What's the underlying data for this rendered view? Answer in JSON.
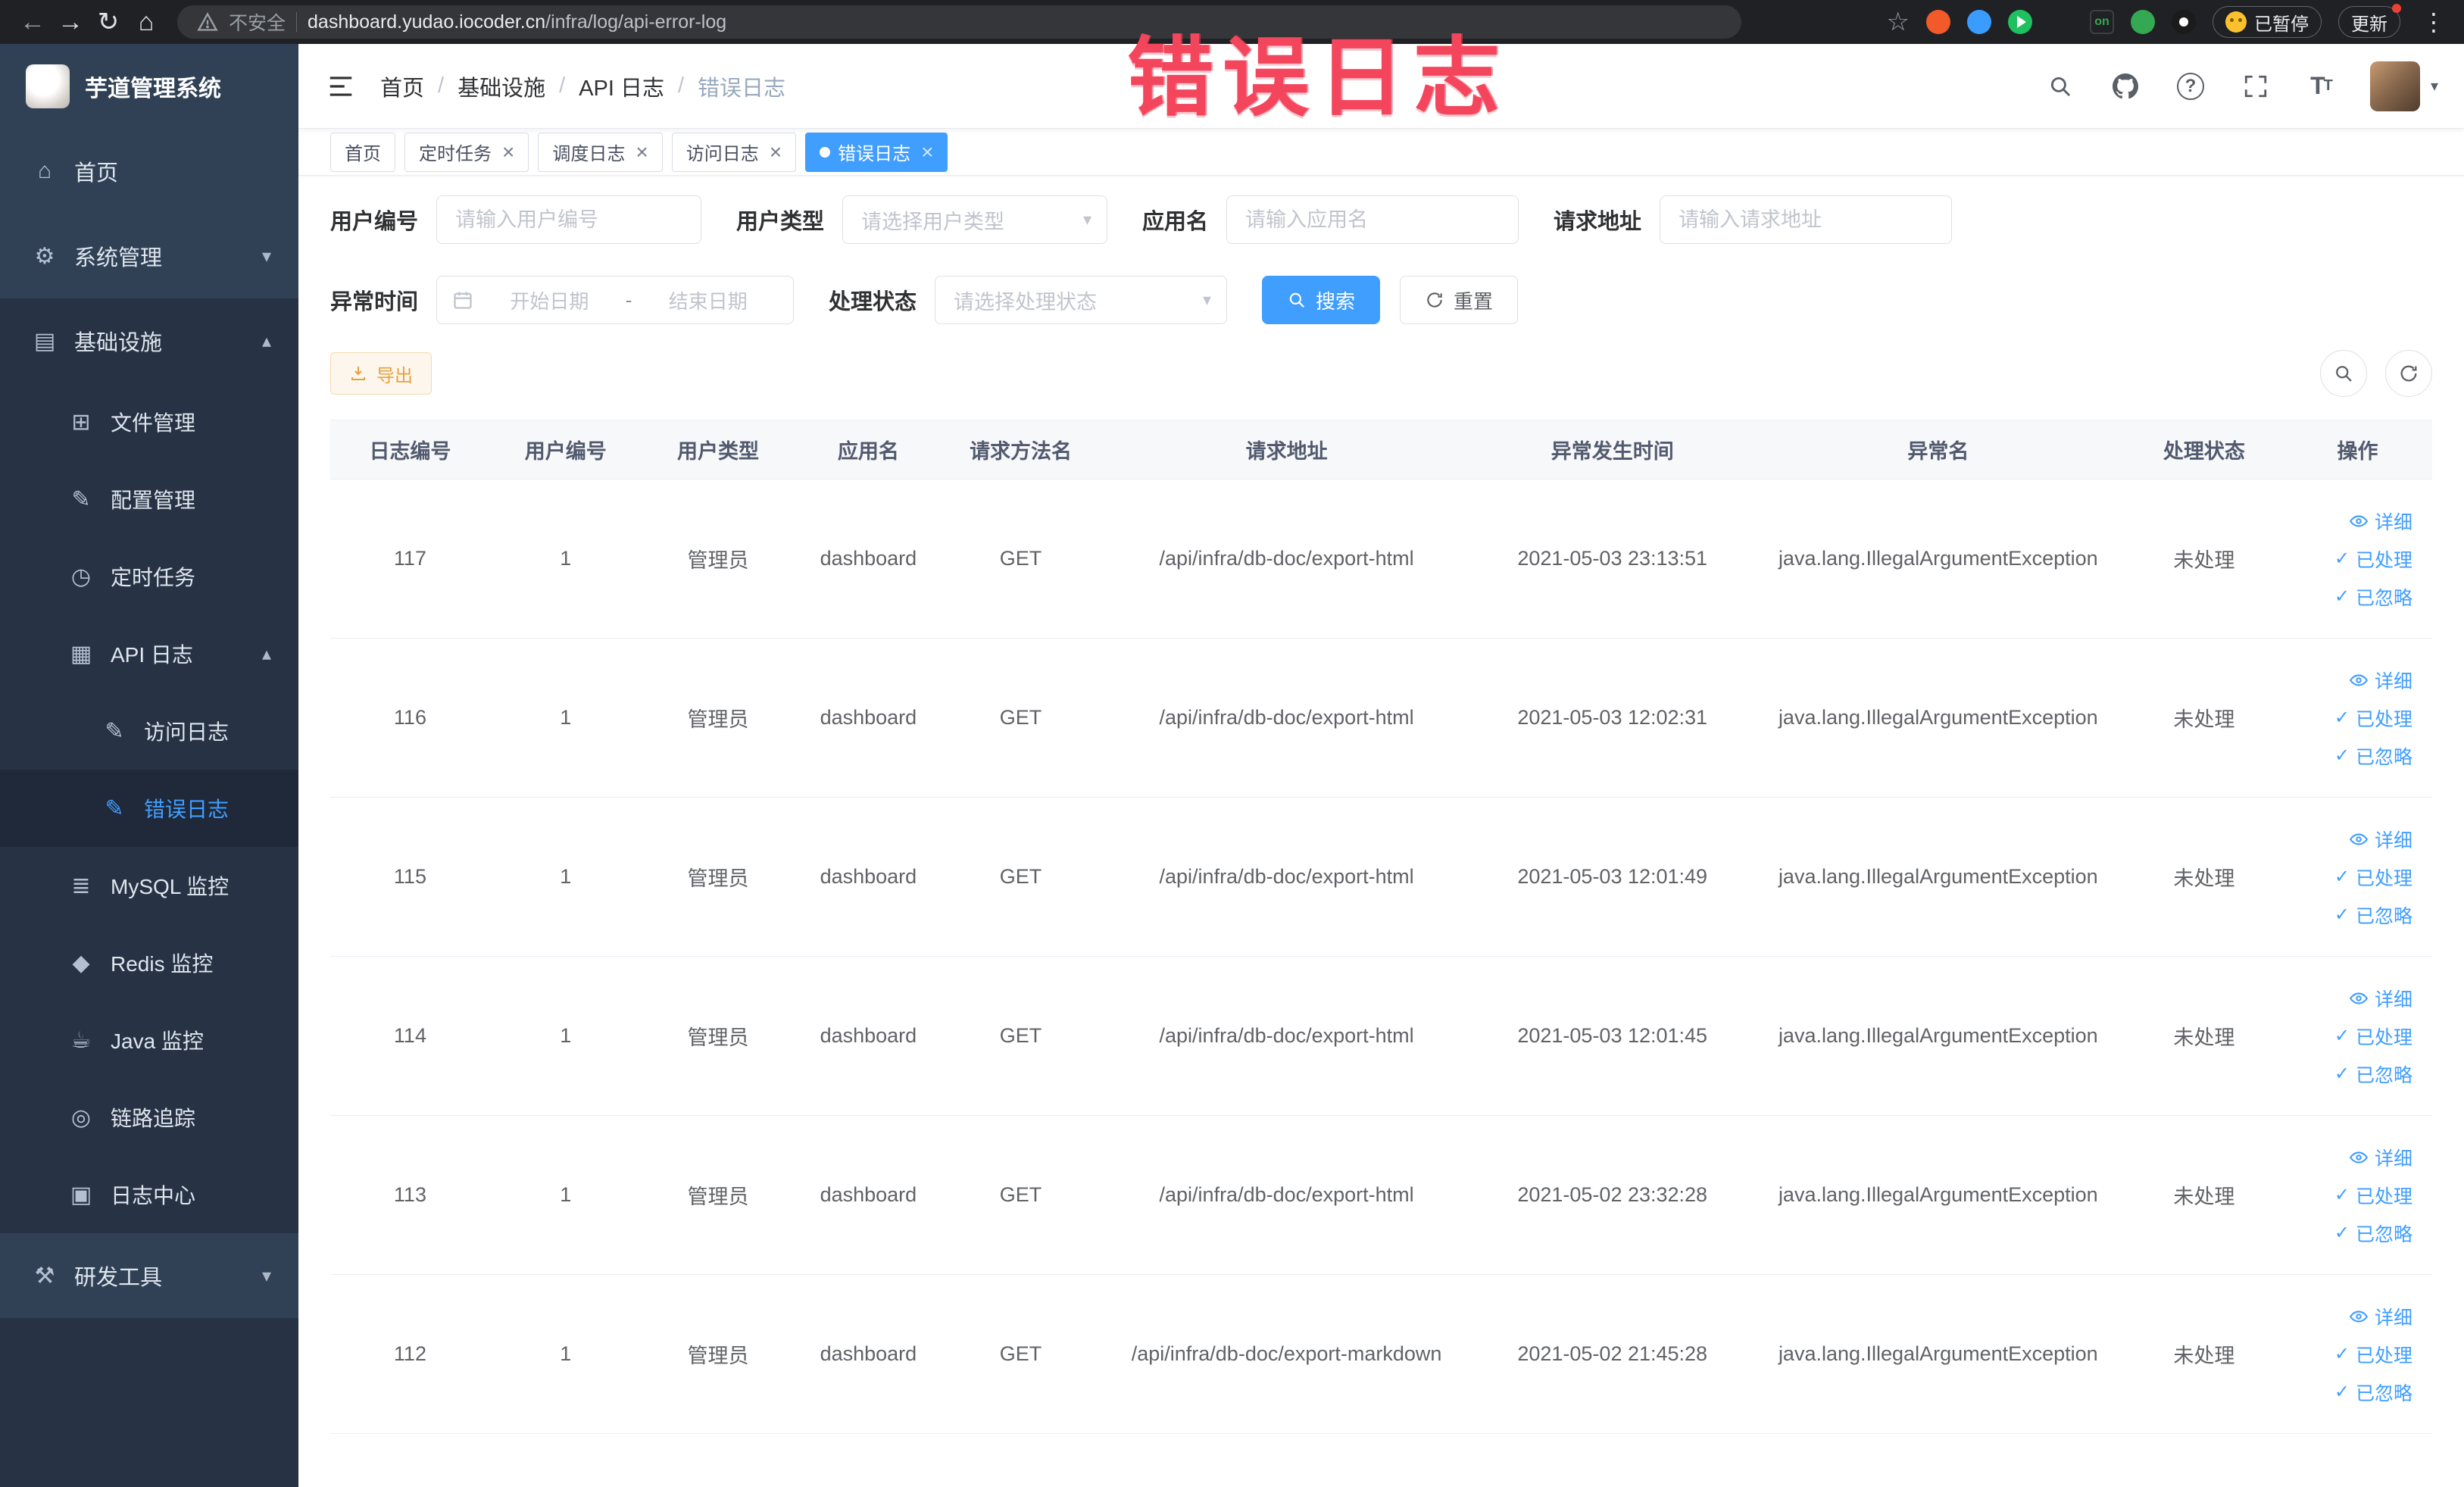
{
  "annotation": {
    "text": "错误日志",
    "color": "#f3455c"
  },
  "browser": {
    "security_label": "不安全",
    "url_domain": "dashboard.yudao.iocoder.cn",
    "url_path": "/infra/log/api-error-log",
    "paused_label": "已暂停",
    "update_label": "更新"
  },
  "extensions": [
    {
      "name": "extension-orange-icon",
      "kind": "circle",
      "color": "#f25a29"
    },
    {
      "name": "extension-blue-drop-icon",
      "kind": "circle",
      "color": "#3b9cff"
    },
    {
      "name": "extension-green-play-icon",
      "kind": "play",
      "color": "#1fc05f"
    },
    {
      "name": "extension-blue-grid-icon",
      "kind": "grid",
      "color": "#4285f4"
    },
    {
      "name": "extension-on-badge-icon",
      "kind": "badge",
      "color": "#202124",
      "label": "on",
      "label_color": "#34a853"
    },
    {
      "name": "extension-green-icon",
      "kind": "circle",
      "color": "#34a853"
    },
    {
      "name": "extension-pin-icon",
      "kind": "pin",
      "color": "#1b1b1b"
    }
  ],
  "sidebar": {
    "logo_title": "芋道管理系统",
    "items": [
      {
        "id": "home",
        "label": "首页",
        "glyph": "⌂",
        "icon_name": "home-icon",
        "level": 1
      },
      {
        "id": "system",
        "label": "系统管理",
        "glyph": "⚙",
        "icon_name": "gear-icon",
        "level": 1,
        "arrow": "down"
      },
      {
        "id": "infra",
        "label": "基础设施",
        "glyph": "▤",
        "icon_name": "monitor-icon",
        "level": 1,
        "arrow": "up",
        "section": true
      },
      {
        "id": "file",
        "label": "文件管理",
        "glyph": "⊞",
        "icon_name": "folder-icon",
        "level": 2,
        "section": true
      },
      {
        "id": "config",
        "label": "配置管理",
        "glyph": "✎",
        "icon_name": "edit-icon",
        "level": 2,
        "section": true
      },
      {
        "id": "job",
        "label": "定时任务",
        "glyph": "◷",
        "icon_name": "clock-icon",
        "level": 2,
        "section": true
      },
      {
        "id": "api-log",
        "label": "API 日志",
        "glyph": "▦",
        "icon_name": "document-icon",
        "level": 2,
        "arrow": "up",
        "section": true
      },
      {
        "id": "access-log",
        "label": "访问日志",
        "glyph": "✎",
        "icon_name": "edit-square-icon",
        "level": 3,
        "section": true
      },
      {
        "id": "error-log",
        "label": "错误日志",
        "glyph": "✎",
        "icon_name": "edit-square-icon",
        "level": 3,
        "section": true,
        "active": true
      },
      {
        "id": "mysql",
        "label": "MySQL 监控",
        "glyph": "≣",
        "icon_name": "database-icon",
        "level": 2,
        "section": true
      },
      {
        "id": "redis",
        "label": "Redis 监控",
        "glyph": "◆",
        "icon_name": "redis-icon",
        "level": 2,
        "section": true
      },
      {
        "id": "java",
        "label": "Java 监控",
        "glyph": "☕",
        "icon_name": "coffee-icon",
        "level": 2,
        "section": true
      },
      {
        "id": "trace",
        "label": "链路追踪",
        "glyph": "◎",
        "icon_name": "trace-icon",
        "level": 2,
        "section": true
      },
      {
        "id": "log-center",
        "label": "日志中心",
        "glyph": "▣",
        "icon_name": "log-center-icon",
        "level": 2,
        "section": true
      },
      {
        "id": "dev-tools",
        "label": "研发工具",
        "glyph": "⚒",
        "icon_name": "tools-icon",
        "level": 1,
        "arrow": "down"
      }
    ]
  },
  "header": {
    "breadcrumb": [
      "首页",
      "基础设施",
      "API 日志",
      "错误日志"
    ]
  },
  "tabs": [
    {
      "id": "home",
      "label": "首页",
      "closable": false,
      "active": false
    },
    {
      "id": "job",
      "label": "定时任务",
      "closable": true,
      "active": false
    },
    {
      "id": "job-log",
      "label": "调度日志",
      "closable": true,
      "active": false
    },
    {
      "id": "access-log",
      "label": "访问日志",
      "closable": true,
      "active": false
    },
    {
      "id": "error-log",
      "label": "错误日志",
      "closable": true,
      "active": true
    }
  ],
  "filters": {
    "user_id_label": "用户编号",
    "user_id_placeholder": "请输入用户编号",
    "user_type_label": "用户类型",
    "user_type_placeholder": "请选择用户类型",
    "app_name_label": "应用名",
    "app_name_placeholder": "请输入应用名",
    "request_url_label": "请求地址",
    "request_url_placeholder": "请输入请求地址",
    "exception_time_label": "异常时间",
    "date_start_placeholder": "开始日期",
    "date_separator": "-",
    "date_end_placeholder": "结束日期",
    "process_status_label": "处理状态",
    "process_status_placeholder": "请选择处理状态",
    "search_label": "搜索",
    "reset_label": "重置"
  },
  "toolbar": {
    "export_label": "导出"
  },
  "table": {
    "columns": [
      "日志编号",
      "用户编号",
      "用户类型",
      "应用名",
      "请求方法名",
      "请求地址",
      "异常发生时间",
      "异常名",
      "处理状态",
      "操作"
    ],
    "actions": [
      {
        "id": "detail",
        "label": "详细",
        "icon": "eye"
      },
      {
        "id": "processed",
        "label": "已处理",
        "icon": "check"
      },
      {
        "id": "ignore",
        "label": "已忽略",
        "icon": "check"
      }
    ],
    "rows": [
      {
        "id": "117",
        "user_id": "1",
        "user_type": "管理员",
        "app": "dashboard",
        "method": "GET",
        "url": "/api/infra/db-doc/export-html",
        "time": "2021-05-03 23:13:51",
        "exception": "java.lang.IllegalArgumentException",
        "status": "未处理"
      },
      {
        "id": "116",
        "user_id": "1",
        "user_type": "管理员",
        "app": "dashboard",
        "method": "GET",
        "url": "/api/infra/db-doc/export-html",
        "time": "2021-05-03 12:02:31",
        "exception": "java.lang.IllegalArgumentException",
        "status": "未处理"
      },
      {
        "id": "115",
        "user_id": "1",
        "user_type": "管理员",
        "app": "dashboard",
        "method": "GET",
        "url": "/api/infra/db-doc/export-html",
        "time": "2021-05-03 12:01:49",
        "exception": "java.lang.IllegalArgumentException",
        "status": "未处理"
      },
      {
        "id": "114",
        "user_id": "1",
        "user_type": "管理员",
        "app": "dashboard",
        "method": "GET",
        "url": "/api/infra/db-doc/export-html",
        "time": "2021-05-03 12:01:45",
        "exception": "java.lang.IllegalArgumentException",
        "status": "未处理"
      },
      {
        "id": "113",
        "user_id": "1",
        "user_type": "管理员",
        "app": "dashboard",
        "method": "GET",
        "url": "/api/infra/db-doc/export-html",
        "time": "2021-05-02 23:32:28",
        "exception": "java.lang.IllegalArgumentException",
        "status": "未处理"
      },
      {
        "id": "112",
        "user_id": "1",
        "user_type": "管理员",
        "app": "dashboard",
        "method": "GET",
        "url": "/api/infra/db-doc/export-markdown",
        "time": "2021-05-02 21:45:28",
        "exception": "java.lang.IllegalArgumentException",
        "status": "未处理"
      }
    ]
  }
}
